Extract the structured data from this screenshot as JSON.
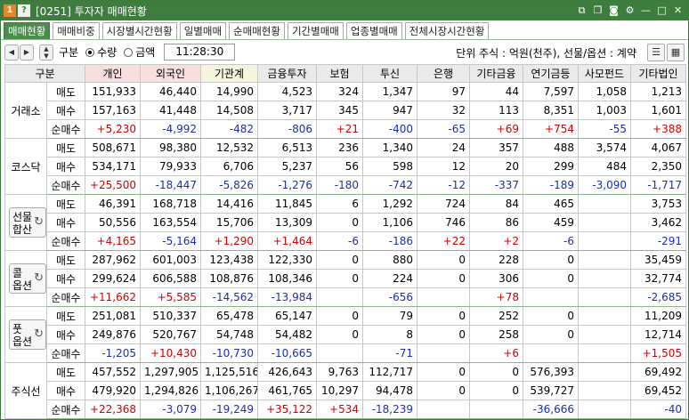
{
  "window": {
    "badge_num": "1",
    "badge_help": "?",
    "title": "[0251] 투자자 매매현황"
  },
  "tabs": [
    "매매현황",
    "매매비중",
    "시장별시간현황",
    "일별매매",
    "순매매현황",
    "기간별매매",
    "업종별매매",
    "전체시장시간현황"
  ],
  "toolbar": {
    "label": "구분",
    "radio_qty": "수량",
    "radio_amt": "금액",
    "time": "11:28:30",
    "unit_text": "단위 주식 : 억원(천주), 선물/옵션 : 계약"
  },
  "table": {
    "headers": [
      "구분",
      "",
      "개인",
      "외국인",
      "기관계",
      "금융투자",
      "보험",
      "투신",
      "은행",
      "기타금융",
      "연기금등",
      "사모펀드",
      "기타법인"
    ],
    "groups": [
      {
        "name": "거래소",
        "button": false,
        "rows": [
          {
            "label": "매도",
            "cells": [
              "151,933",
              "46,440",
              "14,990",
              "4,523",
              "324",
              "1,347",
              "97",
              "44",
              "7,597",
              "1,058",
              "1,213"
            ],
            "signs": [
              "z",
              "z",
              "z",
              "z",
              "z",
              "z",
              "z",
              "z",
              "z",
              "z",
              "z"
            ]
          },
          {
            "label": "매수",
            "cells": [
              "157,163",
              "41,448",
              "14,508",
              "3,717",
              "345",
              "947",
              "32",
              "113",
              "8,351",
              "1,003",
              "1,601"
            ],
            "signs": [
              "z",
              "z",
              "z",
              "z",
              "z",
              "z",
              "z",
              "z",
              "z",
              "z",
              "z"
            ]
          },
          {
            "label": "순매수",
            "cells": [
              "+5,230",
              "-4,992",
              "-482",
              "-806",
              "+21",
              "-400",
              "-65",
              "+69",
              "+754",
              "-55",
              "+388"
            ],
            "signs": [
              "p",
              "n",
              "n",
              "n",
              "p",
              "n",
              "n",
              "p",
              "p",
              "n",
              "p"
            ]
          }
        ]
      },
      {
        "name": "코스닥",
        "button": false,
        "rows": [
          {
            "label": "매도",
            "cells": [
              "508,671",
              "98,380",
              "12,532",
              "6,513",
              "236",
              "1,340",
              "24",
              "357",
              "488",
              "3,574",
              "4,067"
            ],
            "signs": [
              "z",
              "z",
              "z",
              "z",
              "z",
              "z",
              "z",
              "z",
              "z",
              "z",
              "z"
            ]
          },
          {
            "label": "매수",
            "cells": [
              "534,171",
              "79,933",
              "6,706",
              "5,237",
              "56",
              "598",
              "12",
              "20",
              "299",
              "484",
              "2,350"
            ],
            "signs": [
              "z",
              "z",
              "z",
              "z",
              "z",
              "z",
              "z",
              "z",
              "z",
              "z",
              "z"
            ]
          },
          {
            "label": "순매수",
            "cells": [
              "+25,500",
              "-18,447",
              "-5,826",
              "-1,276",
              "-180",
              "-742",
              "-12",
              "-337",
              "-189",
              "-3,090",
              "-1,717"
            ],
            "signs": [
              "p",
              "n",
              "n",
              "n",
              "n",
              "n",
              "n",
              "n",
              "n",
              "n",
              "n"
            ]
          }
        ]
      },
      {
        "name": "선물\n합산",
        "button": true,
        "rows": [
          {
            "label": "매도",
            "cells": [
              "46,391",
              "168,718",
              "14,416",
              "11,845",
              "6",
              "1,292",
              "724",
              "84",
              "465",
              "",
              "3,753"
            ],
            "signs": [
              "z",
              "z",
              "z",
              "z",
              "z",
              "z",
              "z",
              "z",
              "z",
              "z",
              "z"
            ]
          },
          {
            "label": "매수",
            "cells": [
              "50,556",
              "163,554",
              "15,706",
              "13,309",
              "0",
              "1,106",
              "746",
              "86",
              "459",
              "",
              "3,462"
            ],
            "signs": [
              "z",
              "z",
              "z",
              "z",
              "z",
              "z",
              "z",
              "z",
              "z",
              "z",
              "z"
            ]
          },
          {
            "label": "순매수",
            "cells": [
              "+4,165",
              "-5,164",
              "+1,290",
              "+1,464",
              "-6",
              "-186",
              "+22",
              "+2",
              "-6",
              "",
              "-291"
            ],
            "signs": [
              "p",
              "n",
              "p",
              "p",
              "n",
              "n",
              "p",
              "p",
              "n",
              "z",
              "n"
            ]
          }
        ]
      },
      {
        "name": "콜\n옵션",
        "button": true,
        "rows": [
          {
            "label": "매도",
            "cells": [
              "287,962",
              "601,003",
              "123,438",
              "122,330",
              "0",
              "880",
              "0",
              "228",
              "0",
              "",
              "35,459"
            ],
            "signs": [
              "z",
              "z",
              "z",
              "z",
              "z",
              "z",
              "z",
              "z",
              "z",
              "z",
              "z"
            ]
          },
          {
            "label": "매수",
            "cells": [
              "299,624",
              "606,588",
              "108,876",
              "108,346",
              "0",
              "224",
              "0",
              "306",
              "0",
              "",
              "32,774"
            ],
            "signs": [
              "z",
              "z",
              "z",
              "z",
              "z",
              "z",
              "z",
              "z",
              "z",
              "z",
              "z"
            ]
          },
          {
            "label": "순매수",
            "cells": [
              "+11,662",
              "+5,585",
              "-14,562",
              "-13,984",
              "",
              "-656",
              "",
              "+78",
              "",
              "",
              "-2,685"
            ],
            "signs": [
              "p",
              "p",
              "n",
              "n",
              "z",
              "n",
              "z",
              "p",
              "z",
              "z",
              "n"
            ]
          }
        ]
      },
      {
        "name": "풋\n옵션",
        "button": true,
        "rows": [
          {
            "label": "매도",
            "cells": [
              "251,081",
              "510,337",
              "65,478",
              "65,147",
              "0",
              "79",
              "0",
              "252",
              "0",
              "",
              "11,209"
            ],
            "signs": [
              "z",
              "z",
              "z",
              "z",
              "z",
              "z",
              "z",
              "z",
              "z",
              "z",
              "z"
            ]
          },
          {
            "label": "매수",
            "cells": [
              "249,876",
              "520,767",
              "54,748",
              "54,482",
              "0",
              "8",
              "0",
              "258",
              "0",
              "",
              "12,714"
            ],
            "signs": [
              "z",
              "z",
              "z",
              "z",
              "z",
              "z",
              "z",
              "z",
              "z",
              "z",
              "z"
            ]
          },
          {
            "label": "순매수",
            "cells": [
              "-1,205",
              "+10,430",
              "-10,730",
              "-10,665",
              "",
              "-71",
              "",
              "+6",
              "",
              "",
              "+1,505"
            ],
            "signs": [
              "n",
              "p",
              "n",
              "n",
              "z",
              "n",
              "z",
              "p",
              "z",
              "z",
              "p"
            ]
          }
        ]
      },
      {
        "name": "주식선",
        "button": false,
        "rows": [
          {
            "label": "매도",
            "cells": [
              "457,552",
              "1,297,905",
              "1,125,516",
              "426,643",
              "9,763",
              "112,717",
              "0",
              "0",
              "576,393",
              "",
              "69,492"
            ],
            "signs": [
              "z",
              "z",
              "z",
              "z",
              "z",
              "z",
              "z",
              "z",
              "z",
              "z",
              "z"
            ]
          },
          {
            "label": "매수",
            "cells": [
              "479,920",
              "1,294,826",
              "1,106,267",
              "461,765",
              "10,297",
              "94,478",
              "0",
              "0",
              "539,727",
              "",
              "69,452"
            ],
            "signs": [
              "z",
              "z",
              "z",
              "z",
              "z",
              "z",
              "z",
              "z",
              "z",
              "z",
              "z"
            ]
          },
          {
            "label": "순매수",
            "cells": [
              "+22,368",
              "-3,079",
              "-19,249",
              "+35,122",
              "+534",
              "-18,239",
              "",
              "",
              "-36,666",
              "",
              "-40"
            ],
            "signs": [
              "p",
              "n",
              "n",
              "p",
              "p",
              "n",
              "z",
              "z",
              "n",
              "z",
              "n"
            ]
          }
        ]
      }
    ]
  },
  "colors": {
    "title_bar": "#3f7d3f",
    "active_tab": "#4a8c4a",
    "positive": "#d40000",
    "negative": "#1a2fb0"
  }
}
